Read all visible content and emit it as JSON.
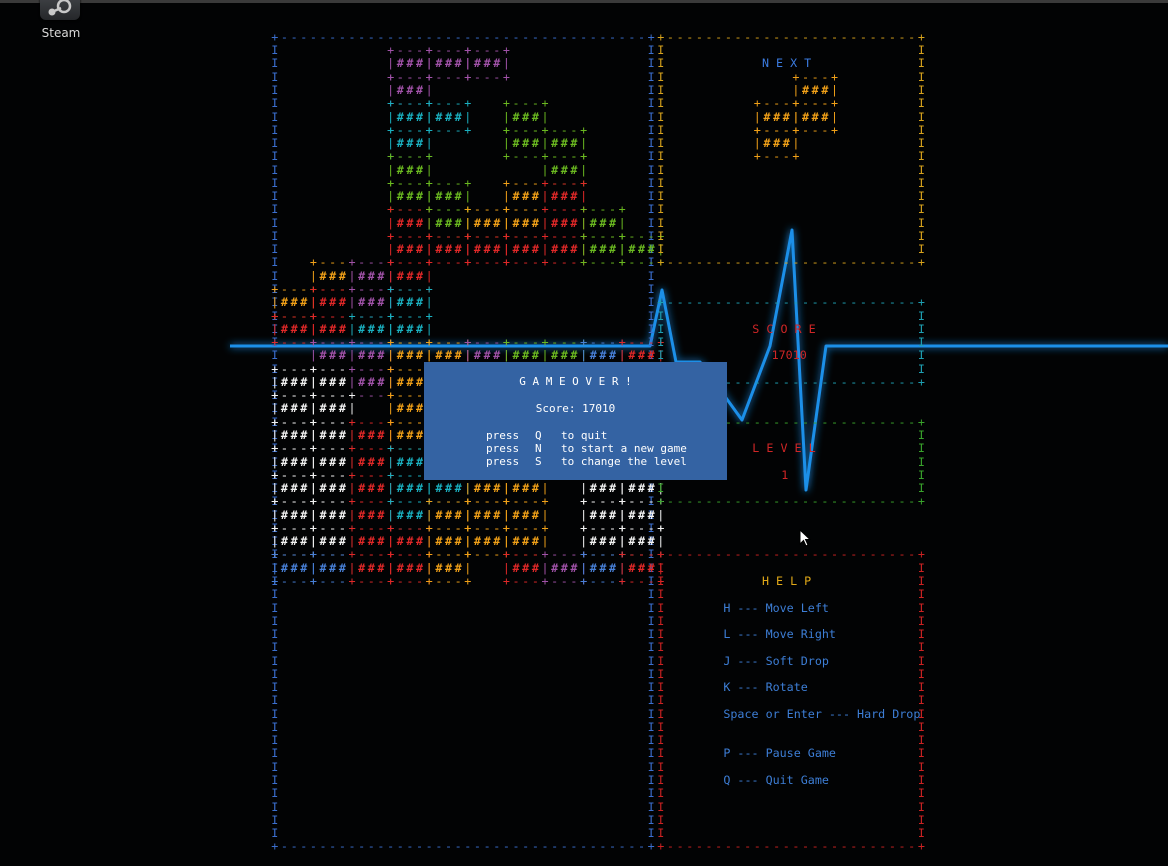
{
  "desktop": {
    "steam_label": "Steam",
    "steam_icon": "steam-logo-icon"
  },
  "colors": {
    "background": "#020304",
    "board_border": "#3b6fcf",
    "next_border": "#d7a21c",
    "score_border": "#1ea0b3",
    "level_border": "#39a32b",
    "help_border": "#cc2222",
    "dialog_bg": "#3463a3",
    "pulse": "#1aa0ff"
  },
  "next_panel": {
    "title": "N E X T",
    "piece": [
      ".#",
      "##",
      "#."
    ],
    "piece_color": "orange"
  },
  "score_panel": {
    "title": "S C O R E",
    "value": "17010"
  },
  "level_panel": {
    "title": "L E V E L",
    "value": "1"
  },
  "help_panel": {
    "title": "H E L P",
    "lines": [
      "H --- Move Left",
      "L --- Move Right",
      "J --- Soft Drop",
      "K --- Rotate",
      "Space or Enter --- Hard Drop",
      "P --- Pause Game",
      "Q --- Quit Game"
    ]
  },
  "dialog": {
    "title": "G A M E  O V E R !",
    "score_line": "Score: 17010",
    "options": [
      {
        "press": "press",
        "key": "Q",
        "action": "to quit"
      },
      {
        "press": "press",
        "key": "N",
        "action": "to start a new game"
      },
      {
        "press": "press",
        "key": "S",
        "action": "to change the level"
      }
    ]
  },
  "board": {
    "columns": 10,
    "rows": 20,
    "legend": {
      "P": "#a052a8",
      "C": "#1ab0c0",
      "G": "#6ab820",
      "R": "#e02828",
      "O": "#f0a018",
      "B": "#4880d8",
      "W": "#f2f2f2"
    },
    "grid": [
      "...PPP....",
      "...P......",
      "...CC.G...",
      "...C..GG..",
      "...G...G..",
      "...GG.OR..",
      "...RGOORG.",
      "...RRRRRGG",
      ".OPR......",
      "ORPC......",
      "RRCC......",
      ".PPOOPGGBR",
      "WWPOO.BBBB",
      "WW.OOCPPBB",
      "WWRO.CCPWW",
      "WWRC.COPWW",
      "WWRCCOO.WW",
      "WWRCOOO.WW",
      "WWRROOO.WW",
      "BBRRO.RPBR"
    ]
  }
}
